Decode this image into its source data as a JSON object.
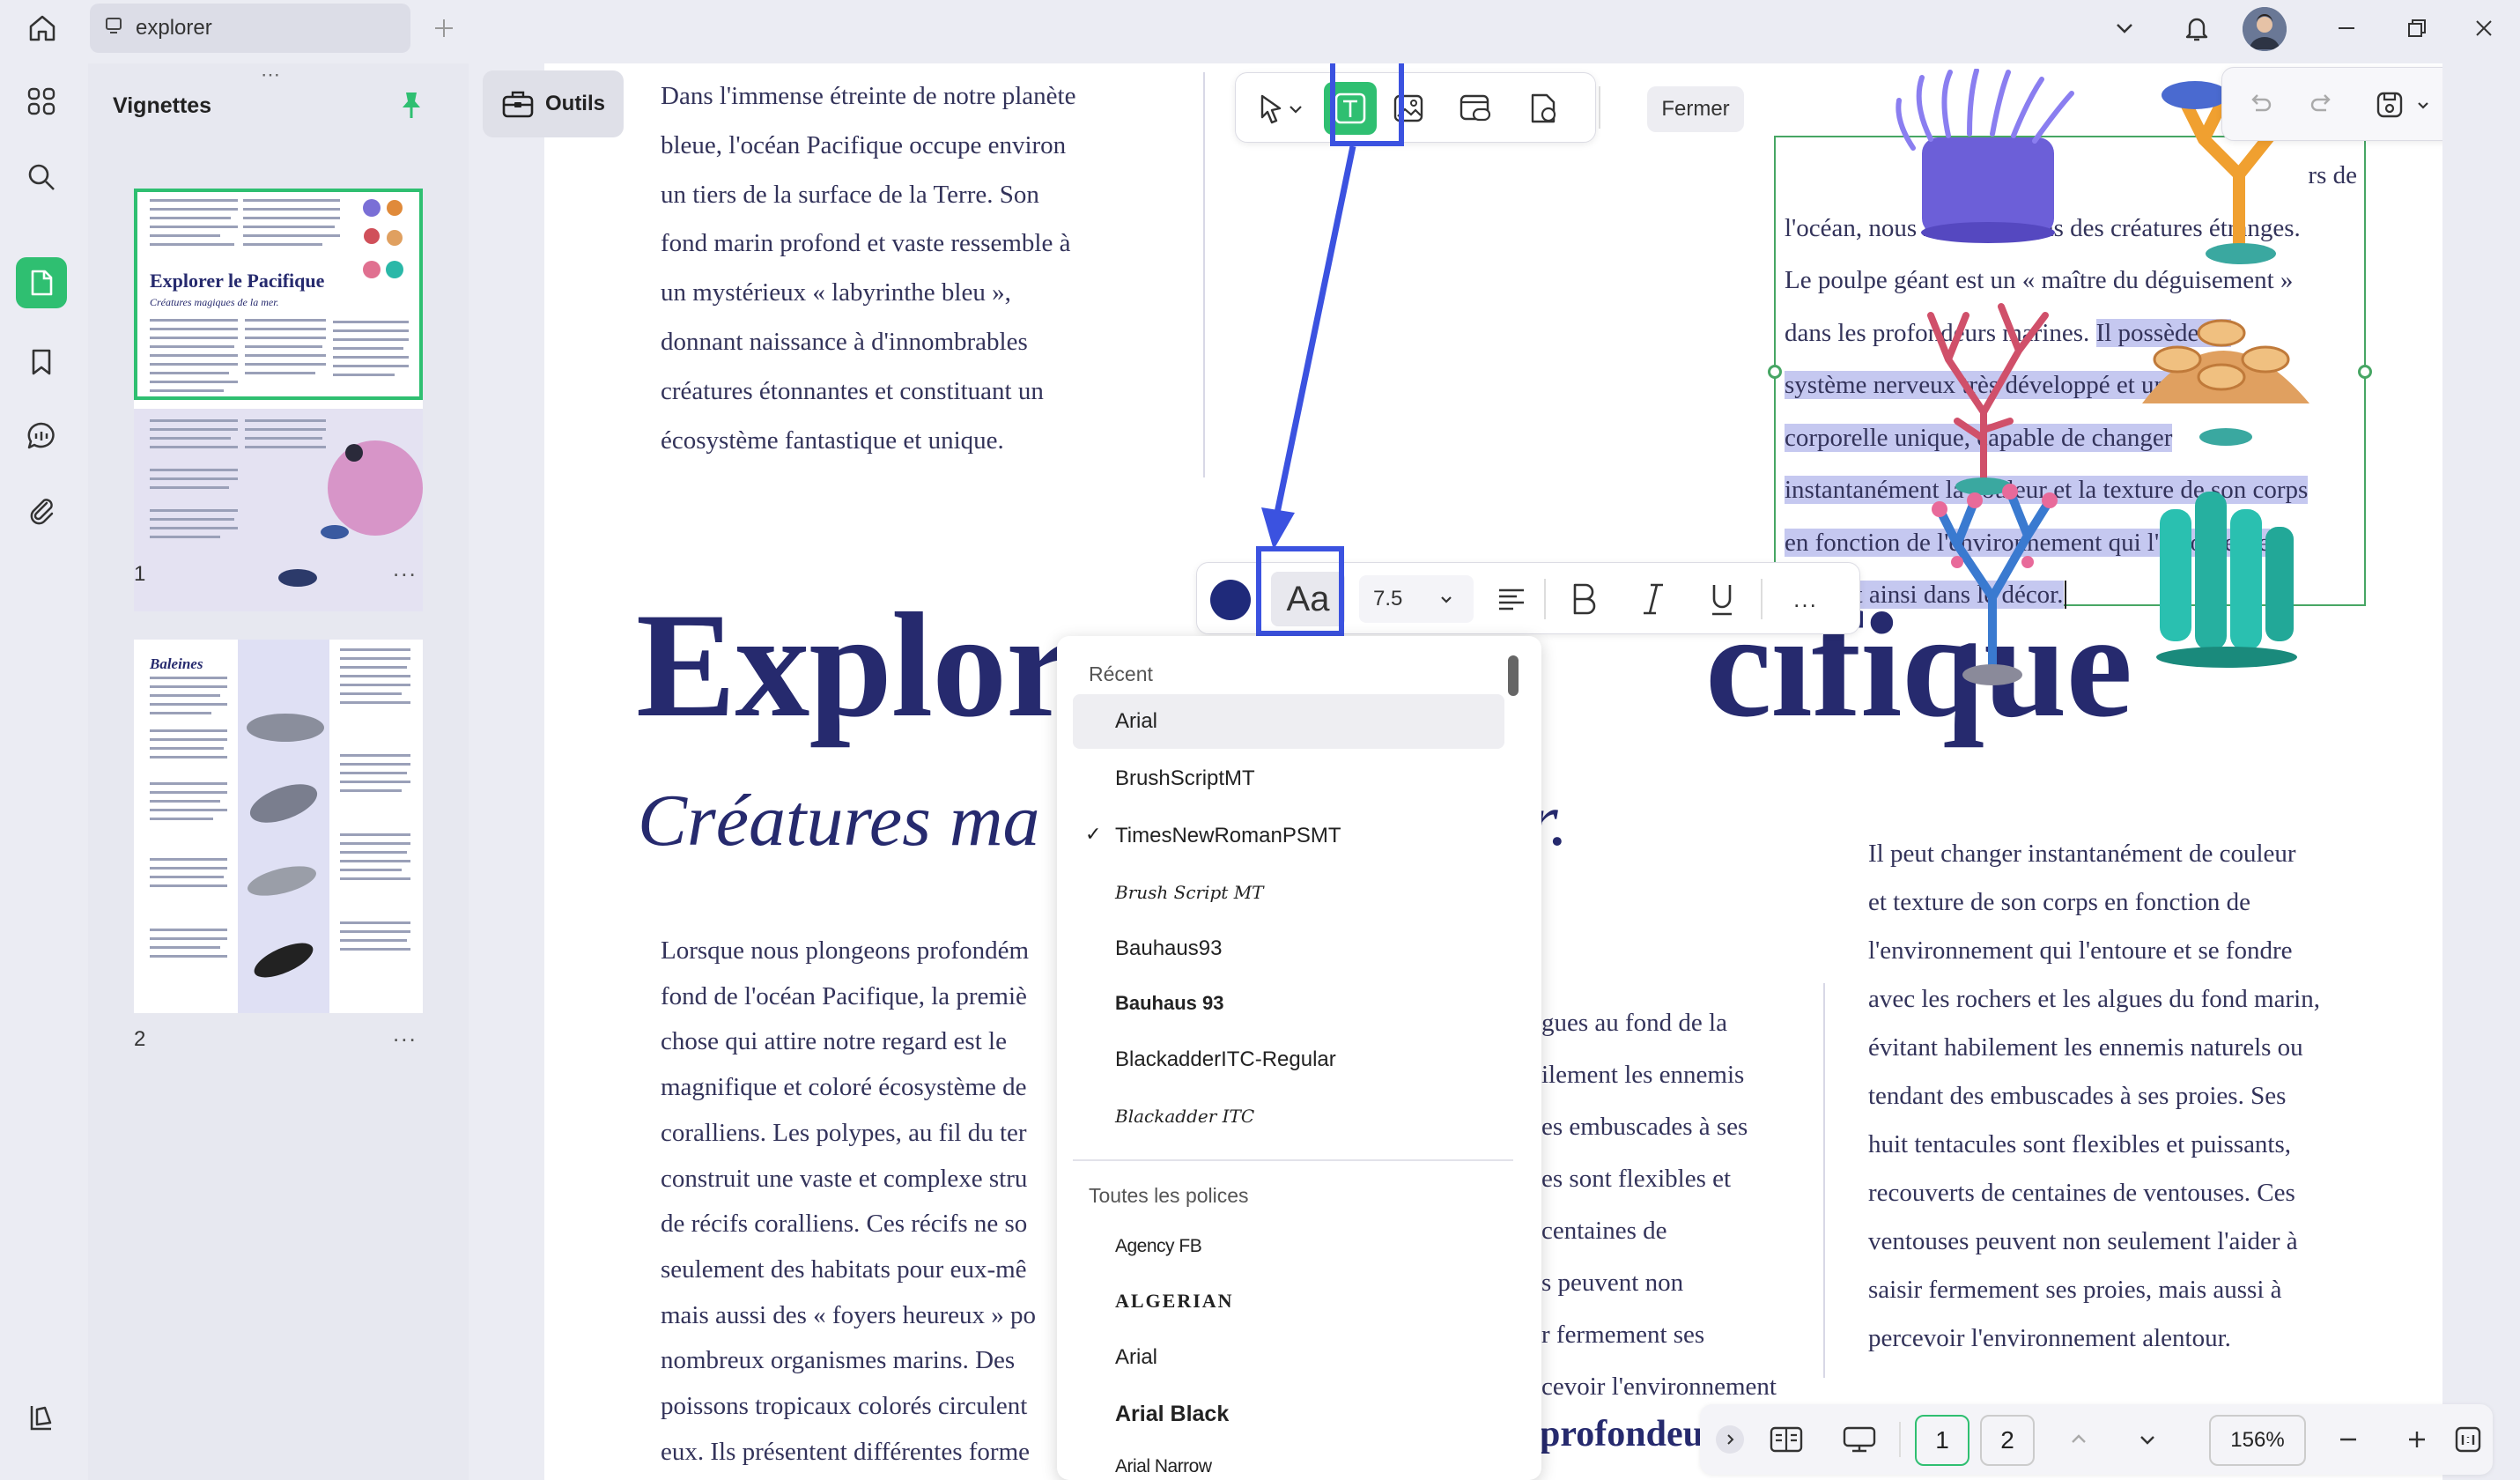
{
  "window": {
    "tab_title": "explorer"
  },
  "thumbnails": {
    "title": "Vignettes",
    "page1": {
      "number": "1",
      "title": "Explorer le Pacifique",
      "subtitle": "Créatures magiques de la mer."
    },
    "page2": {
      "number": "2",
      "title": "Baleines"
    },
    "more": "..."
  },
  "tools": {
    "label": "Outils"
  },
  "toolbar": {
    "close_label": "Fermer"
  },
  "format_bar": {
    "font_size": "7.5",
    "font_button": "Aa",
    "more": "..."
  },
  "document": {
    "intro_text": [
      "Dans l'immense étreinte de notre planète",
      "bleue, l'océan Pacifique occupe environ",
      "un tiers de la surface de la Terre. Son",
      "fond marin profond et vaste ressemble à",
      "un mystérieux « labyrinthe bleu »,",
      "donnant naissance à d'innombrables",
      "créatures étonnantes et constituant un",
      "écosystème fantastique et unique."
    ],
    "textbox_lines": {
      "l1": "rs de",
      "l2": "l'océan, nous rencontrerons des créatures étranges.",
      "l3": "Le poulpe géant est un « maître du déguisement »",
      "l4a": "dans les profondeurs marines. ",
      "l4b": "Il possède un",
      "l5": "système nerveux très développé et une structure",
      "l6": "corporelle unique, capable de changer",
      "l7": "instantanément la couleur et la texture de son corps",
      "l8": "en fonction de l'environnement qui l'entoure, se",
      "l9": "fondant ainsi dans le décor."
    },
    "title_left": "Explor",
    "title_right": "cifique",
    "subtitle_left": "Créatures ma",
    "subtitle_right": "r.",
    "left_column": [
      "Lorsque nous plongeons profondém",
      "fond de l'océan Pacifique, la premiè",
      "chose qui attire notre regard est le",
      "magnifique et coloré écosystème de",
      "coralliens. Les polypes, au fil du ter",
      "construit une vaste et complexe stru",
      "de récifs coralliens. Ces récifs ne so",
      "seulement des habitats pour eux-mê",
      "mais aussi des « foyers heureux » po",
      "nombreux organismes marins. Des",
      "poissons tropicaux colorés circulent",
      "eux. Ils présentent différentes forme"
    ],
    "middle_column": [
      "gues au fond de la",
      "ilement les ennemis",
      "es embuscades à ses",
      "es sont flexibles et",
      "centaines de",
      "s peuvent non",
      "r fermement ses",
      "cevoir l'environnement"
    ],
    "right_column": [
      "Il peut changer instantanément de couleur",
      "et texture de son corps en fonction de",
      "l'environnement qui l'entoure et se fondre",
      "avec les rochers et les algues du fond marin,",
      "évitant habilement les ennemis naturels ou",
      "tendant des embuscades à ses proies. Ses",
      "huit tentacules sont flexibles et puissants,",
      "recouverts de centaines de ventouses. Ces",
      "ventouses peuvent non seulement l'aider à",
      "saisir fermement ses proies, mais aussi à",
      "percevoir l'environnement alentour."
    ],
    "bottom_heading": "profondeu"
  },
  "font_menu": {
    "recent_header": "Récent",
    "all_header": "Toutes les polices",
    "check": "✓",
    "recent": [
      "Arial",
      "BrushScriptMT",
      "TimesNewRomanPSMT",
      "Brush Script MT",
      "Bauhaus93",
      "Bauhaus 93",
      "BlackadderITC-Regular",
      "Blackadder ITC"
    ],
    "all": [
      "Agency FB",
      "ALGERIAN",
      "Arial",
      "Arial Black",
      "Arial Narrow"
    ]
  },
  "navigation": {
    "page1": "1",
    "page2": "2",
    "zoom": "156%"
  },
  "colors": {
    "accent_green": "#2fbf71",
    "annotation_blue": "#3b52e0",
    "title_navy": "#262a6e",
    "text_color": "#33335a",
    "selection": "#c5c8f0",
    "font_color_swatch": "#1f2a7a"
  }
}
